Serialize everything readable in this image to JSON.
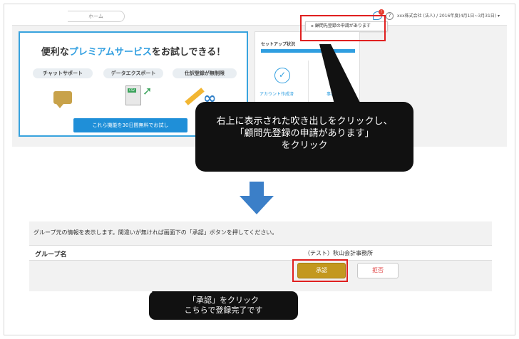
{
  "top_screen": {
    "breadcrumb": "ホーム",
    "chat_badge": "!",
    "help_glyph": "?",
    "company": "xxx株式会社 (法人) / 2016年度(4月1日~3月31日) ▾",
    "dropdown_item": "▸ 顧問先登録の申請があります"
  },
  "promo": {
    "title_pre": "便利な",
    "title_hl": "プレミアムサービス",
    "title_post": "をお試しできる！",
    "features": [
      "チャットサポート",
      "データエクスポート",
      "仕訳登録が無制限"
    ],
    "doc_badge": "CSV",
    "infinity": "∞",
    "button": "これら機能を30日間無料でお試し"
  },
  "setup": {
    "title": "セットアップ状況",
    "percent": "",
    "progress": 1.0,
    "check": "✓",
    "label_account": "アカウント作成済",
    "label_office": "事業所"
  },
  "callout_top": {
    "lines": [
      "右上に表示された吹き出しをクリックし、",
      "「顧問先登録の申請があります」",
      "をクリック"
    ]
  },
  "bottom_screen": {
    "info": "グループ元の情報を表示します。間違いが無ければ画面下の「承認」ボタンを押してください。",
    "group_label": "グループ名",
    "group_value": "（テスト）秋山会計事務所",
    "approve": "承認",
    "reject": "拒否"
  },
  "callout_bottom": {
    "lines": [
      "「承認」をクリック",
      "こちらで登録完了です"
    ]
  },
  "colors": {
    "accent_blue": "#2f9ee0",
    "highlight_red": "#e02020",
    "approve_gold": "#c3981f",
    "arrow_blue": "#3b7fc8"
  }
}
